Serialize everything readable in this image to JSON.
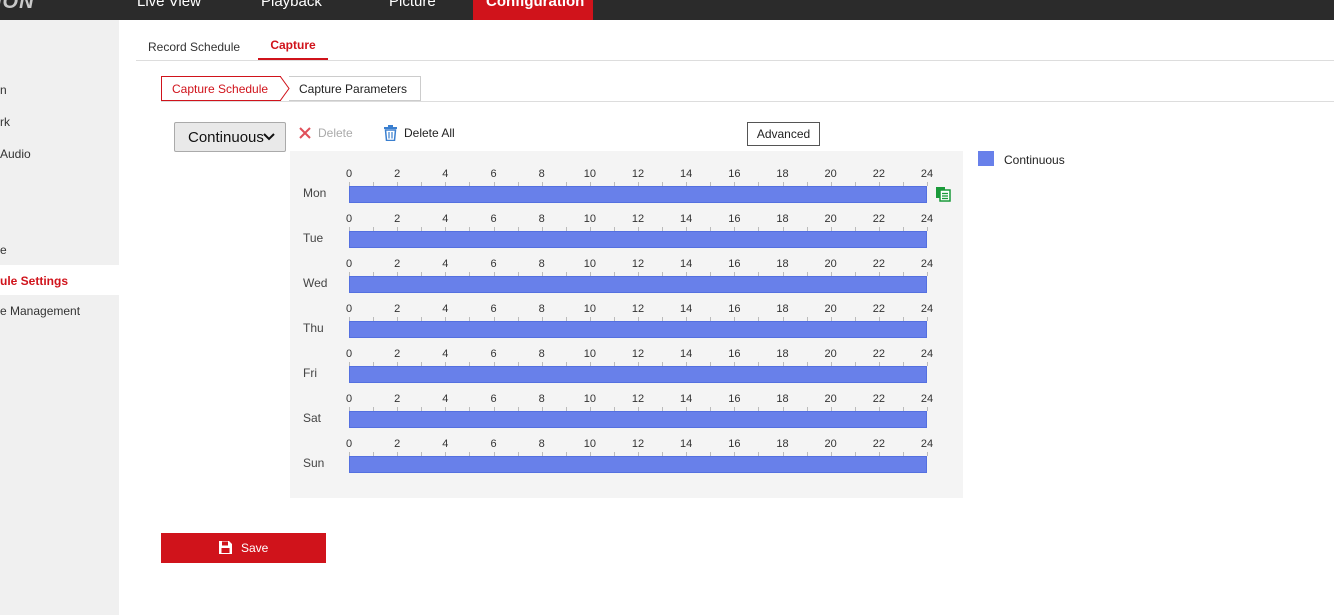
{
  "app": {
    "logo_text": "ION"
  },
  "top_nav": {
    "live_view": "Live View",
    "playback": "Playback",
    "picture": "Picture",
    "configuration": "Configuration"
  },
  "sidebar": {
    "items": [
      {
        "label": "n",
        "active": false
      },
      {
        "label": "rk",
        "active": false
      },
      {
        "label": "Audio",
        "active": false
      },
      {
        "label": "e",
        "active": false
      },
      {
        "label": "ule Settings",
        "active": true
      },
      {
        "label": "e Management",
        "active": false
      }
    ]
  },
  "tabs": {
    "record_schedule": "Record Schedule",
    "capture": "Capture",
    "active": "Capture"
  },
  "subtabs": {
    "capture_schedule": "Capture Schedule",
    "capture_parameters": "Capture Parameters",
    "active": "Capture Schedule"
  },
  "toolbar": {
    "type_selected": "Continuous",
    "delete_label": "Delete",
    "delete_enabled": false,
    "delete_all_label": "Delete All",
    "advanced_label": "Advanced"
  },
  "schedule": {
    "hour_ticks": [
      "0",
      "2",
      "4",
      "6",
      "8",
      "10",
      "12",
      "14",
      "16",
      "18",
      "20",
      "22",
      "24"
    ],
    "days": [
      {
        "label": "Mon",
        "segments": [
          {
            "start": 0,
            "end": 24,
            "type": "Continuous"
          }
        ]
      },
      {
        "label": "Tue",
        "segments": [
          {
            "start": 0,
            "end": 24,
            "type": "Continuous"
          }
        ]
      },
      {
        "label": "Wed",
        "segments": [
          {
            "start": 0,
            "end": 24,
            "type": "Continuous"
          }
        ]
      },
      {
        "label": "Thu",
        "segments": [
          {
            "start": 0,
            "end": 24,
            "type": "Continuous"
          }
        ]
      },
      {
        "label": "Fri",
        "segments": [
          {
            "start": 0,
            "end": 24,
            "type": "Continuous"
          }
        ]
      },
      {
        "label": "Sat",
        "segments": [
          {
            "start": 0,
            "end": 24,
            "type": "Continuous"
          }
        ]
      },
      {
        "label": "Sun",
        "segments": [
          {
            "start": 0,
            "end": 24,
            "type": "Continuous"
          }
        ]
      }
    ]
  },
  "legend": {
    "items": [
      {
        "label": "Continuous",
        "color": "#6880ea"
      }
    ]
  },
  "save_button": {
    "label": "Save"
  },
  "colors": {
    "accent": "#d0131b",
    "topbar": "#2b2b2b",
    "schedule_bar": "#6880ea",
    "copy_icon": "#1a9a3a"
  },
  "icons": {
    "delete": "close-x-icon",
    "delete_all": "trash-icon",
    "copy": "copy-icon",
    "save": "floppy-disk-icon",
    "select": "chevron-down-icon"
  }
}
